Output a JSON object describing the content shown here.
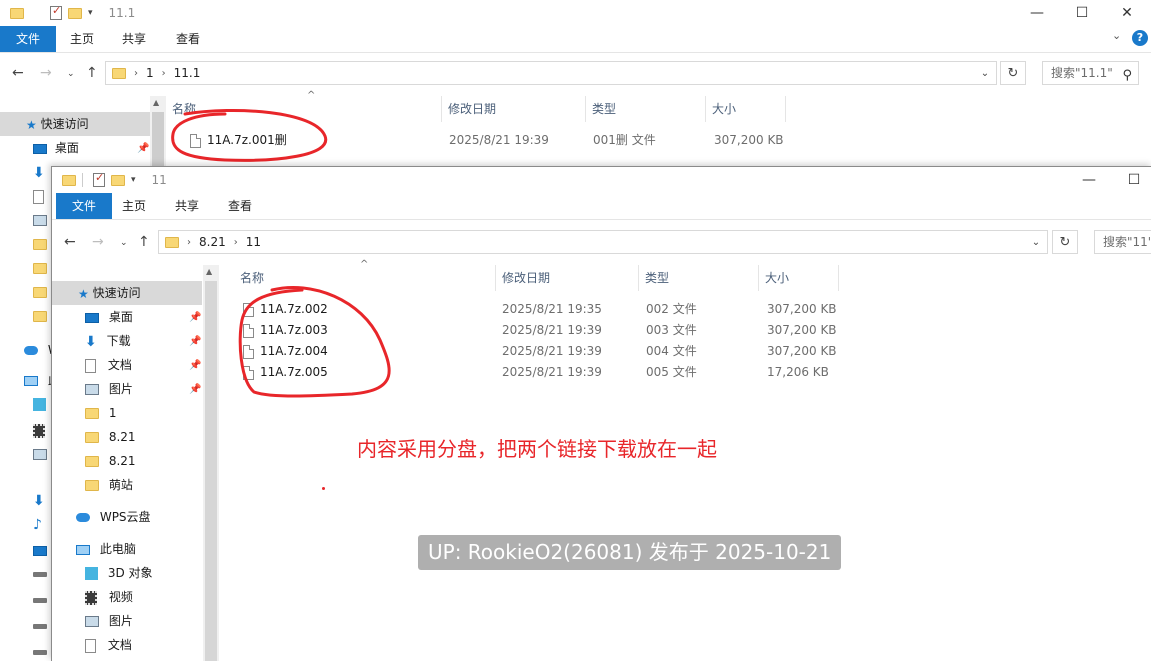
{
  "back_window": {
    "title": "11.1",
    "ribbon_tabs": [
      "文件",
      "主页",
      "共享",
      "查看"
    ],
    "help": "?",
    "address_crumbs": [
      "1",
      "11.1"
    ],
    "search_placeholder": "搜索\"11.1\"",
    "nav_items": [
      {
        "label": "快速访问",
        "icon": "star-icon"
      },
      {
        "label": "桌面",
        "icon": "desktop-icon"
      }
    ],
    "nav_partial": [
      {
        "label": "W",
        "icon": "cloud-icon"
      },
      {
        "label": "此",
        "icon": "pc-icon"
      }
    ],
    "columns": [
      "名称",
      "修改日期",
      "类型",
      "大小"
    ],
    "files": [
      {
        "name": "11A.7z.001删",
        "date": "2025/8/21 19:39",
        "type": "001删 文件",
        "size": "307,200 KB"
      }
    ]
  },
  "front_window": {
    "title": "11",
    "ribbon_tabs": [
      "文件",
      "主页",
      "共享",
      "查看"
    ],
    "address_crumbs": [
      "8.21",
      "11"
    ],
    "search_placeholder": "搜索\"11\"",
    "nav_items": [
      {
        "label": "快速访问",
        "icon": "star-icon",
        "pinned": false
      },
      {
        "label": "桌面",
        "icon": "desktop-icon",
        "pinned": true
      },
      {
        "label": "下载",
        "icon": "download-icon",
        "pinned": true
      },
      {
        "label": "文档",
        "icon": "document-icon",
        "pinned": true
      },
      {
        "label": "图片",
        "icon": "picture-icon",
        "pinned": true
      },
      {
        "label": "1",
        "icon": "folder-icon",
        "pinned": false
      },
      {
        "label": "8.21",
        "icon": "folder-icon",
        "pinned": false
      },
      {
        "label": "8.21",
        "icon": "folder-icon",
        "pinned": false
      },
      {
        "label": "萌站",
        "icon": "folder-icon",
        "pinned": false
      },
      {
        "label": "WPS云盘",
        "icon": "cloud-icon",
        "pinned": false
      },
      {
        "label": "此电脑",
        "icon": "pc-icon",
        "pinned": false
      },
      {
        "label": "3D 对象",
        "icon": "cube-icon",
        "pinned": false
      },
      {
        "label": "视频",
        "icon": "video-icon",
        "pinned": false
      },
      {
        "label": "图片",
        "icon": "picture-icon",
        "pinned": false
      },
      {
        "label": "文档",
        "icon": "document-icon",
        "pinned": false
      }
    ],
    "columns": [
      "名称",
      "修改日期",
      "类型",
      "大小"
    ],
    "files": [
      {
        "name": "11A.7z.002",
        "date": "2025/8/21 19:35",
        "type": "002 文件",
        "size": "307,200 KB"
      },
      {
        "name": "11A.7z.003",
        "date": "2025/8/21 19:39",
        "type": "003 文件",
        "size": "307,200 KB"
      },
      {
        "name": "11A.7z.004",
        "date": "2025/8/21 19:39",
        "type": "004 文件",
        "size": "307,200 KB"
      },
      {
        "name": "11A.7z.005",
        "date": "2025/8/21 19:39",
        "type": "005 文件",
        "size": "17,206 KB"
      }
    ]
  },
  "annotation_text": "内容采用分盘，把两个链接下载放在一起",
  "watermark_text": "UP: RookieO2(26081) 发布于 2025-10-21",
  "colors": {
    "accent": "#1979ca",
    "annotation": "#e8262a",
    "folder": "#f8d775"
  }
}
